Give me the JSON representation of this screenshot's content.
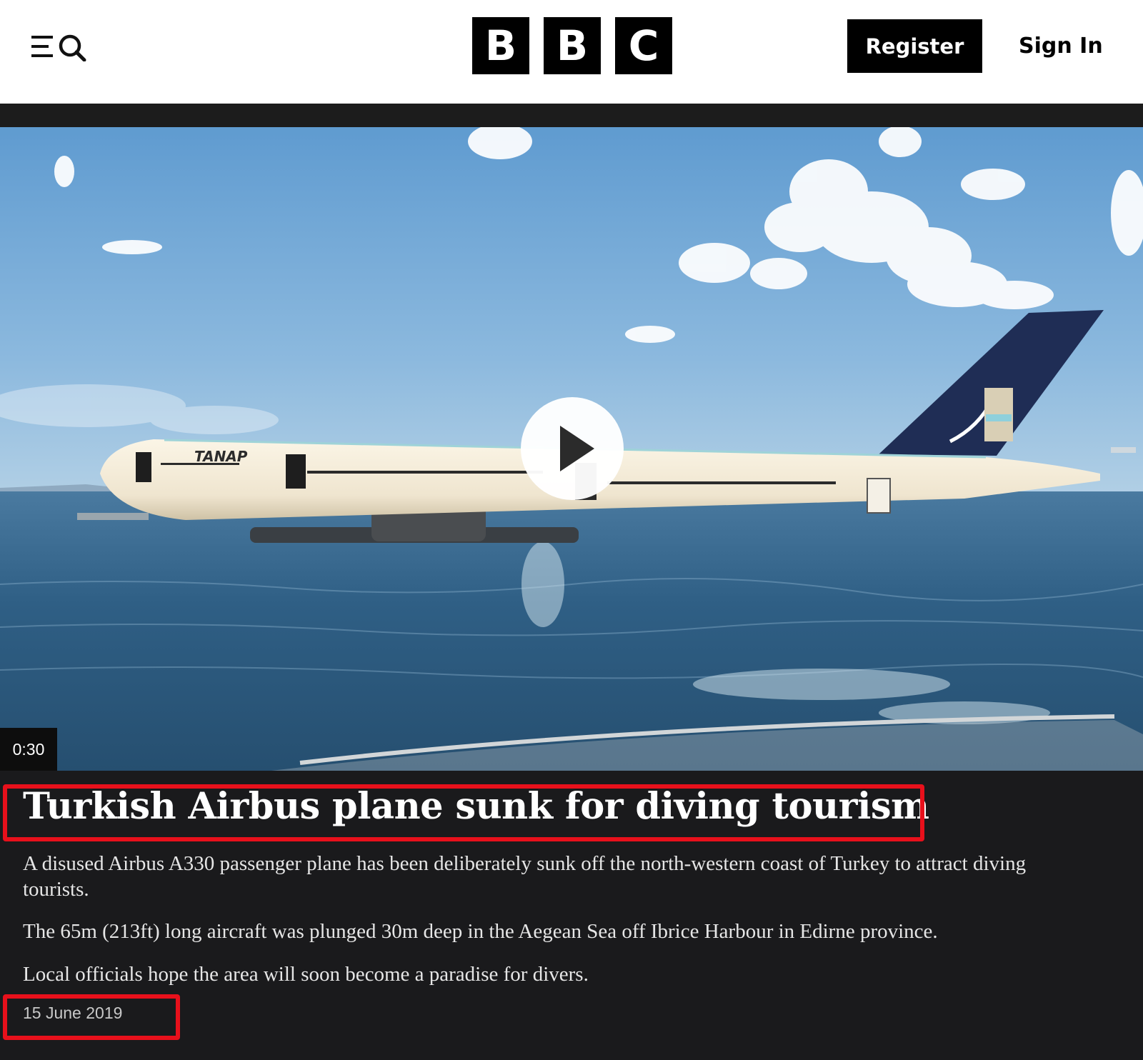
{
  "header": {
    "logo_letters": [
      "B",
      "B",
      "C"
    ],
    "register_label": "Register",
    "signin_label": "Sign In",
    "menu_icon": "menu-search-icon"
  },
  "video": {
    "duration": "0:30",
    "play_icon": "play-icon",
    "plane_text": "TANAP"
  },
  "article": {
    "headline": "Turkish Airbus plane sunk for diving tourism",
    "paragraphs": [
      "A disused Airbus A330 passenger plane has been deliberately sunk off the north-western coast of Turkey to attract diving tourists.",
      "The 65m (213ft) long aircraft was plunged 30m deep in the Aegean Sea off Ibrice Harbour in Edirne province.",
      "Local officials hope the area will soon become a paradise for divers."
    ],
    "date": "15 June 2019"
  },
  "colors": {
    "highlight_red": "#e8101b",
    "page_bg": "#1a1a1c",
    "header_bg": "#ffffff"
  }
}
